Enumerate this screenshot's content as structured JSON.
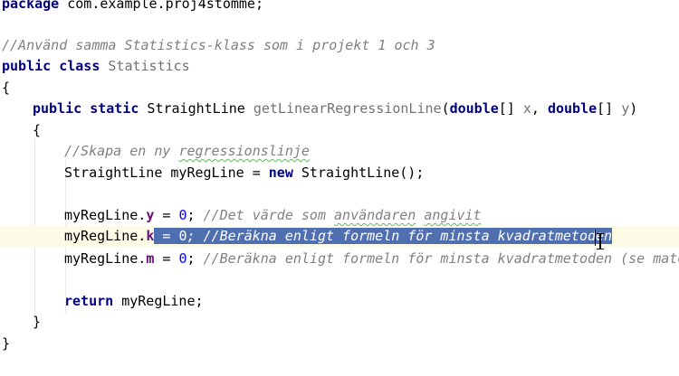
{
  "code": {
    "l1": {
      "package_kw": "package",
      "package_name": " com.example.proj4stomme;"
    },
    "l3": {
      "comment": "//Använd samma Statistics-klass som i projekt 1 och 3"
    },
    "l4": {
      "kw": "public class",
      "name": " Statistics"
    },
    "l5": {
      "brace": "{"
    },
    "l6": {
      "kw1": "public static",
      "type": " StraightLine ",
      "method": "getLinearRegressionLine",
      "open": "(",
      "ptype1": "double",
      "arr1": "[] ",
      "pname1": "x",
      "comma": ", ",
      "ptype2": "double",
      "arr2": "[] ",
      "pname2": "y",
      "close": ")"
    },
    "l7": {
      "brace": "{"
    },
    "l8": {
      "comment_prefix": "//Skapa en ny ",
      "comment_word": "regressionslinje"
    },
    "l9": {
      "decl": "StraightLine myRegLine = ",
      "kw_new": "new",
      "ctor": " StraightLine();"
    },
    "l11": {
      "obj": "myRegLine.",
      "field": "y",
      "assign": " = ",
      "num": "0",
      "semi": "; ",
      "comment_prefix": "//Det värde som ",
      "comment_word1": "användaren",
      "comment_space": " ",
      "comment_word2": "angivit"
    },
    "l12": {
      "obj": "myRegLine.",
      "field": "k",
      "sel_assign": " = ",
      "sel_num": "0",
      "sel_rest": "; //Beräkna enligt formeln för minsta kvadratmetoden"
    },
    "l13": {
      "obj": "myRegLine.",
      "field": "m",
      "assign": " = ",
      "num": "0",
      "semi": "; ",
      "comment": "//Beräkna enligt formeln för minsta kvadratmetoden (se materi"
    },
    "l15": {
      "kw_return": "return",
      "rest": " myRegLine;"
    },
    "l16": {
      "brace": "}"
    },
    "l17": {
      "brace": "}"
    }
  },
  "colors": {
    "keyword": "#000080",
    "comment": "#808080",
    "number": "#0000ff",
    "field": "#660e7a",
    "selection": "#4f6fb0",
    "current_line": "#fdfbe6"
  },
  "icons": {
    "cursor": "text-cursor-ibeam-icon"
  }
}
